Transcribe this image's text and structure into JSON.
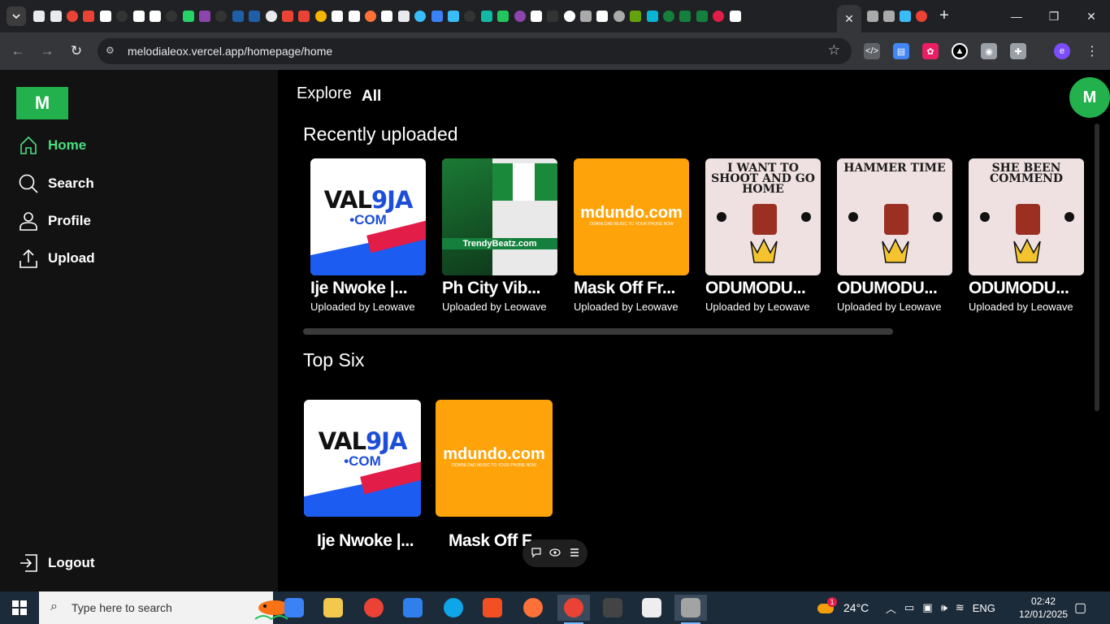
{
  "browser": {
    "url": "melodialeox.vercel.app/homepage/home",
    "favicon_colors": [
      "#e8eaed",
      "#e8eaed",
      "#ea4335",
      "#ea4335",
      "#ffffff",
      "#333333",
      "#ffffff",
      "#ffffff",
      "#333333",
      "#25d366",
      "#8e44ad",
      "#333333",
      "#1f5fa8",
      "#1f5fa8",
      "#e8eaed",
      "#ea4335",
      "#ea4335",
      "#f4b400",
      "#ffffff",
      "#ffffff",
      "#ff7139",
      "#ffffff",
      "#e8eaed",
      "#38bdf8",
      "#3b82f6",
      "#38bdf8",
      "#333333",
      "#14b8a6",
      "#22c55e",
      "#8e44ad",
      "#ffffff",
      "#333333",
      "#ffffff",
      "#aaaaaa",
      "#ffffff",
      "#aaaaaa",
      "#65a30d",
      "#06b6d4",
      "#15803d",
      "#15803d",
      "#15803d",
      "#e11d48",
      "#ffffff"
    ],
    "active_tab_close": "✕",
    "new_tab": "+",
    "window_controls": [
      "—",
      "❐",
      "✕"
    ],
    "extensions": [
      {
        "name": "code-extension-icon",
        "color": "#5f6368",
        "glyph": "</>"
      },
      {
        "name": "docs-extension-icon",
        "color": "#4285f4",
        "glyph": "▤"
      },
      {
        "name": "color-picker-extension-icon",
        "color": "#e91e63",
        "glyph": "✿"
      },
      {
        "name": "vercel-extension-icon",
        "color": "#ffffff",
        "glyph": "▲"
      },
      {
        "name": "camera-extension-icon",
        "color": "#9aa0a6",
        "glyph": "◉"
      },
      {
        "name": "puzzle-extension-icon",
        "color": "#9aa0a6",
        "glyph": "✚"
      }
    ],
    "profile_initial": "e",
    "menu_glyph": "⋮"
  },
  "sidebar": {
    "logo": "M",
    "items": [
      {
        "label": "Home",
        "active": true
      },
      {
        "label": "Search",
        "active": false
      },
      {
        "label": "Profile",
        "active": false
      },
      {
        "label": "Upload",
        "active": false
      }
    ],
    "logout": "Logout"
  },
  "header": {
    "explore": "Explore",
    "filter": "All",
    "avatar_initial": "M"
  },
  "sections": {
    "recent": {
      "title": "Recently uploaded",
      "cards": [
        {
          "title": "Ije Nwoke |...",
          "uploader": "Uploaded by Leowave",
          "art": "val9ja"
        },
        {
          "title": "Ph City Vib...",
          "uploader": "Uploaded by Leowave",
          "art": "trendy"
        },
        {
          "title": "Mask Off Fr...",
          "uploader": "Uploaded by Leowave",
          "art": "mdundo"
        },
        {
          "title": "ODUMODU...",
          "uploader": "Uploaded by Leowave",
          "art": "odu",
          "art_text": "I WANT TO SHOOT AND GO HOME"
        },
        {
          "title": "ODUMODU...",
          "uploader": "Uploaded by Leowave",
          "art": "odu",
          "art_text": "HAMMER TIME"
        },
        {
          "title": "ODUMODU...",
          "uploader": "Uploaded by Leowave",
          "art": "odu",
          "art_text": "SHE BEEN COMMEND"
        }
      ]
    },
    "top": {
      "title": "Top Six",
      "cards": [
        {
          "title": "Ije Nwoke |...",
          "art": "val9ja"
        },
        {
          "title": "Mask Off F",
          "art": "mdundo"
        }
      ]
    }
  },
  "art": {
    "val9ja_word": "VAL",
    "val9ja_accent": "9JA",
    "val9ja_dotcom": "•COM",
    "trendy_band": "TrendyBeatz.com",
    "mdundo_main": "mdundo.com",
    "mdundo_sub": "DOWNLOAD MUSIC TO YOUR PHONE NOW"
  },
  "taskbar": {
    "search_placeholder": "Type here to search",
    "apps": [
      {
        "name": "app-store-icon",
        "color": "#3b82f6"
      },
      {
        "name": "file-explorer-icon",
        "color": "#f2c94c"
      },
      {
        "name": "chrome-icon",
        "color": "#ea4335"
      },
      {
        "name": "vscode-icon",
        "color": "#2f80ed"
      },
      {
        "name": "edge-icon",
        "color": "#0ea5e9"
      },
      {
        "name": "ms-store-icon",
        "color": "#f25022"
      },
      {
        "name": "firefox-icon",
        "color": "#ff7139"
      },
      {
        "name": "chrome-profile-icon",
        "color": "#ea4335"
      },
      {
        "name": "terminal-icon",
        "color": "#444444"
      },
      {
        "name": "obs-icon",
        "color": "#eeeeee"
      },
      {
        "name": "paint-icon",
        "color": "#a3a3a3"
      }
    ],
    "weather": "24°C",
    "weather_badge": "1",
    "language": "ENG",
    "time": "02:42",
    "date": "12/01/2025"
  }
}
